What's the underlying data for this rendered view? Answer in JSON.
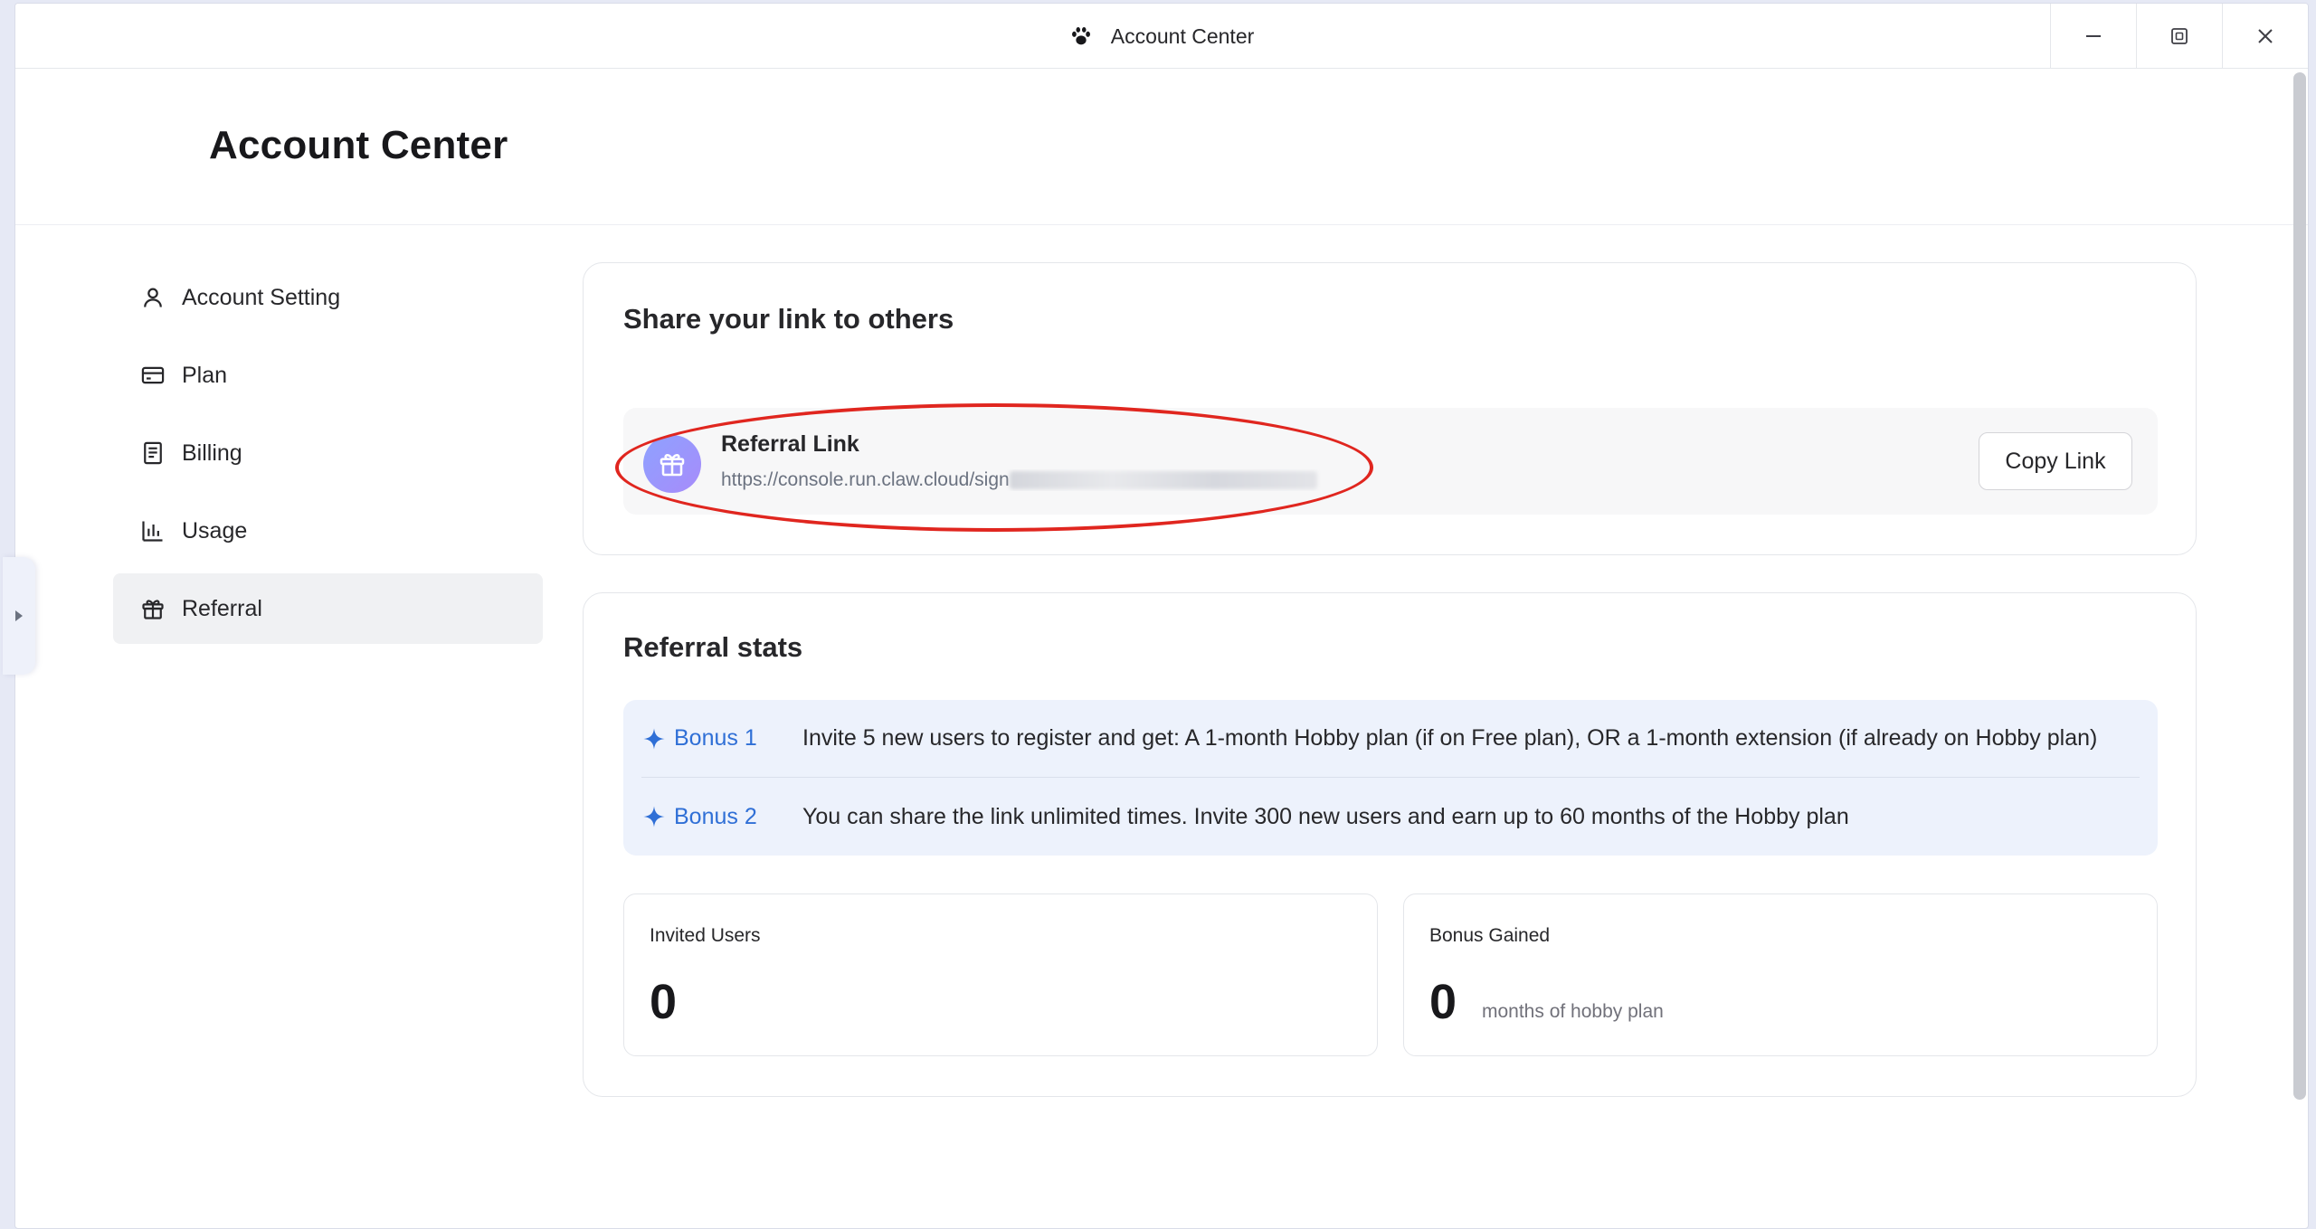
{
  "window": {
    "title": "Account Center",
    "app_icon": "paw-icon",
    "controls": [
      "minimize-icon",
      "restore-icon",
      "close-icon"
    ]
  },
  "page": {
    "title": "Account Center"
  },
  "sidebar": {
    "items": [
      {
        "label": "Account Setting",
        "icon": "user-icon",
        "active": false
      },
      {
        "label": "Plan",
        "icon": "credit-card-icon",
        "active": false
      },
      {
        "label": "Billing",
        "icon": "receipt-icon",
        "active": false
      },
      {
        "label": "Usage",
        "icon": "bar-chart-icon",
        "active": false
      },
      {
        "label": "Referral",
        "icon": "gift-icon",
        "active": true
      }
    ]
  },
  "share": {
    "title": "Share your link to others",
    "link_label": "Referral Link",
    "link_url": "https://console.run.claw.cloud/sign",
    "copy_label": "Copy Link"
  },
  "stats": {
    "title": "Referral stats",
    "bonuses": [
      {
        "tag": "Bonus 1",
        "text": "Invite 5 new users to register and get: A 1-month Hobby plan (if on Free plan), OR a 1-month extension (if already on Hobby plan)"
      },
      {
        "tag": "Bonus 2",
        "text": "You can share the link unlimited times. Invite 300 new users and earn up to 60 months of the Hobby plan"
      }
    ],
    "invited_label": "Invited Users",
    "invited_value": "0",
    "gained_label": "Bonus Gained",
    "gained_value": "0",
    "gained_unit": "months of hobby plan"
  },
  "colors": {
    "accent": "#2f6fd6",
    "highlight": "#e0261f",
    "bonus_bg": "#edf2fc"
  }
}
